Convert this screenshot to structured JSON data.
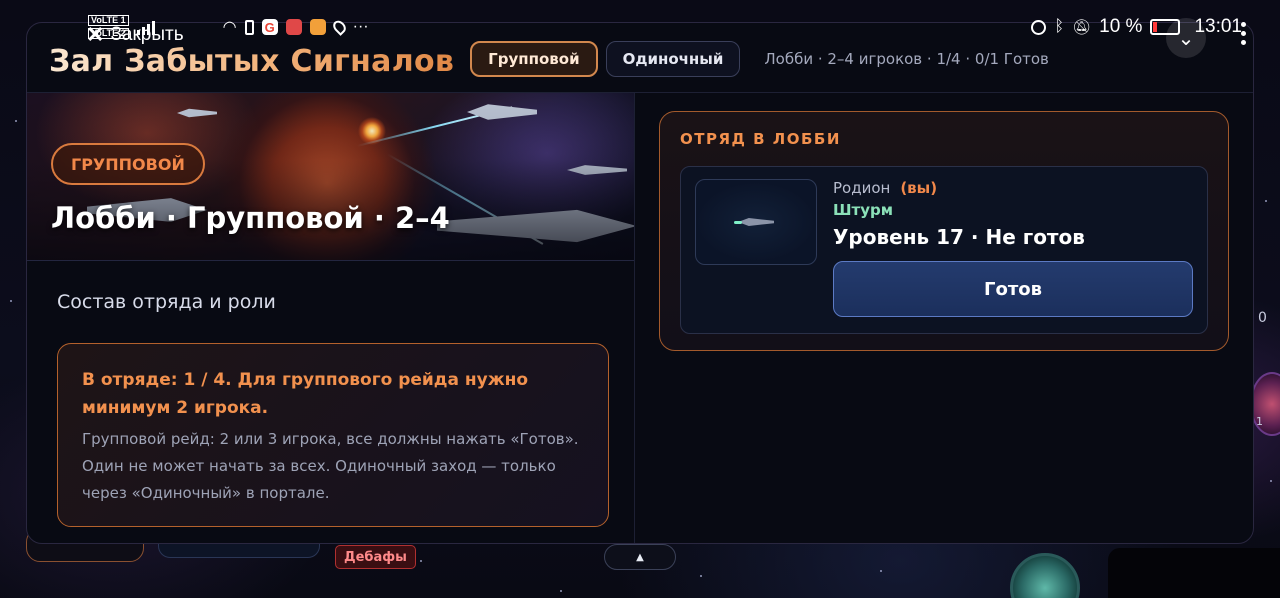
{
  "status_bar": {
    "volte_1": "VoLTE 1",
    "volte_2": "VoLTE 2",
    "more_indicator": "···",
    "battery_percent": "10 %",
    "time": "13:01"
  },
  "close_button": {
    "label": "Закрыть"
  },
  "header": {
    "title": "Зал Забытых Сигналов",
    "modes": [
      {
        "label": "Групповой",
        "active": true
      },
      {
        "label": "Одиночный",
        "active": false
      }
    ],
    "lobby_status": "Лобби · 2–4 игроков · 1/4 · 0/1 Готов"
  },
  "hero": {
    "badge": "ГРУППОВОЙ",
    "title": "Лобби · Групповой · 2–4"
  },
  "left": {
    "section_title": "Состав отряда и роли",
    "notice": {
      "title": "В отряде: 1 / 4. Для группового рейда нужно минимум 2 игрока.",
      "text": "Групповой рейд: 2 или 3 игрока, все должны нажать «Готов». Один не может начать за всех. Одиночный заход — только через «Одиночный» в портале."
    }
  },
  "squad": {
    "title": "ОТРЯД В ЛОББИ",
    "members": [
      {
        "name": "Родион",
        "you_label": "(вы)",
        "role": "Штурм",
        "level_status": "Уровень 17 · Не готов",
        "ready_label": "Готов"
      }
    ]
  },
  "background": {
    "debuff_label": "Дебафы",
    "scroll_up_symbol": "▲",
    "edge_number": "0",
    "edge_number_small": "1"
  },
  "colors": {
    "accent_orange": "#f2914e",
    "role_green": "#8be0b8",
    "ready_blue": "#243b6e"
  }
}
